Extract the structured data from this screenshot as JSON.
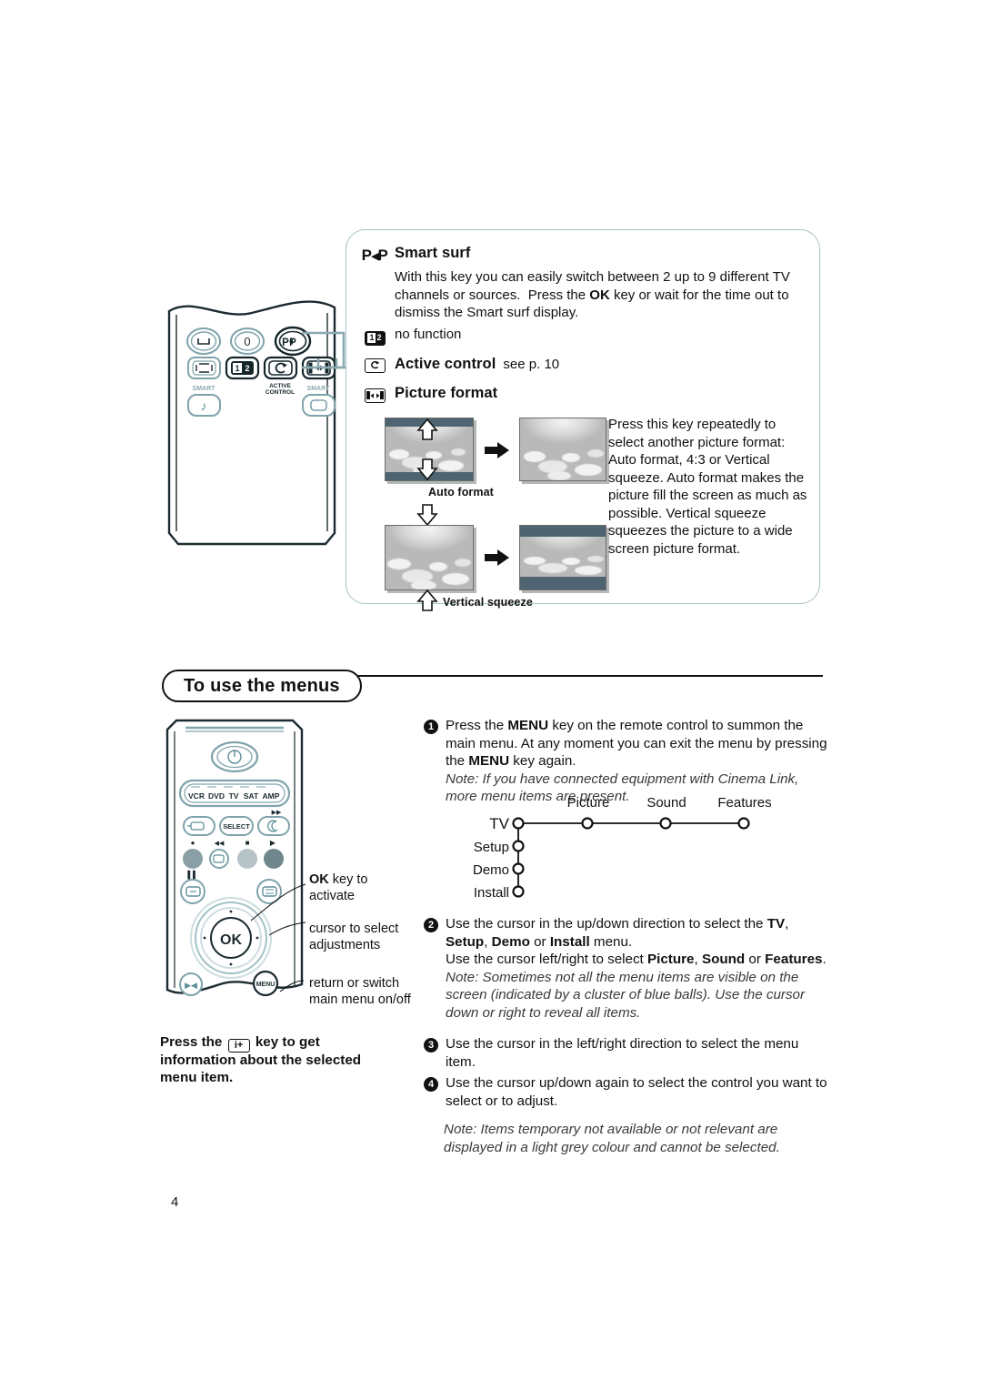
{
  "page_number": "4",
  "top_panel": {
    "smart_surf": {
      "key_glyph": "P-P",
      "title": "Smart surf",
      "body": "With this key you can easily switch between 2 up to 9 different TV channels or sources.  Press the OK key or wait for the time out to dismiss the Smart surf display."
    },
    "no_function": {
      "key_glyph": "12",
      "label": "no function"
    },
    "active_control": {
      "key_glyph": "active-control-icon",
      "title": "Active control",
      "suffix": "see p. 10"
    },
    "picture_format": {
      "key_glyph": "picture-format-icon",
      "title": "Picture format",
      "caption_auto": "Auto format",
      "caption_vertical": "Vertical squeeze",
      "body": "Press this key repeatedly to select another picture format: Auto format, 4:3 or Vertical squeeze. Auto format makes the picture fill the screen as much as possible. Vertical squeeze squeezes the picture to a wide screen picture format."
    }
  },
  "remote_top": {
    "labels": {
      "smart_picture": "SMART",
      "active_control": "ACTIVE CONTROL",
      "smart_sound": "SMART"
    },
    "keys": {
      "zero": "0",
      "pp": "P-P"
    }
  },
  "section": {
    "title": "To use the menus"
  },
  "steps": [
    {
      "number": "1",
      "lines": [
        {
          "type": "text",
          "value": "Press the MENU key on the remote control to summon the main menu. At any moment you can exit the menu by pressing the MENU key again."
        },
        {
          "type": "note",
          "value": "Note: If you have connected equipment with Cinema Link, more menu items are present."
        }
      ]
    },
    {
      "number": "2",
      "lines": [
        {
          "type": "text",
          "value": "Use the cursor in the up/down direction to select the TV, Setup, Demo or Install menu."
        },
        {
          "type": "text",
          "value": "Use the cursor left/right to select Picture, Sound or Features."
        },
        {
          "type": "note",
          "value": "Note: Sometimes not all the menu items are visible on the screen (indicated by a cluster of blue balls). Use the cursor down or right to reveal all items."
        }
      ]
    },
    {
      "number": "3",
      "lines": [
        {
          "type": "text",
          "value": "Use the cursor in the left/right direction to select the menu item."
        }
      ]
    },
    {
      "number": "4",
      "lines": [
        {
          "type": "text",
          "value": "Use the cursor up/down again to select the control you want to select or to adjust."
        },
        {
          "type": "note",
          "value": "Note: Items temporary not available or not relevant are displayed in a light grey colour and cannot be selected."
        }
      ]
    }
  ],
  "menu_tree": {
    "rows": [
      "TV",
      "Setup",
      "Demo",
      "Install"
    ],
    "columns": [
      "Picture",
      "Sound",
      "Features"
    ]
  },
  "callouts": {
    "ok_key": "OK key to activate",
    "cursor": "cursor to select adjustments",
    "menu": "return or switch main menu on/off"
  },
  "remote_bottom": {
    "source_labels": [
      "VCR",
      "DVD",
      "TV",
      "SAT",
      "AMP"
    ],
    "select": "SELECT",
    "ok": "OK",
    "menu": "MENU"
  },
  "bottom_left_note": {
    "before": "Press the",
    "glyph": "i+",
    "after": "key to get information about the selected menu item."
  },
  "colors": {
    "card_border": "#a8c3c8",
    "remote_stroke": "#1c2b30",
    "remote_button": "#7fa3ab",
    "letterbox_bar": "#4e6470",
    "ink": "#111111"
  }
}
